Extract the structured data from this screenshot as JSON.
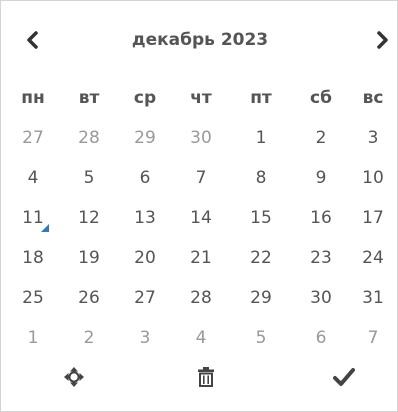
{
  "header": {
    "month_title": "декабрь 2023"
  },
  "weekdays": [
    "пн",
    "вт",
    "ср",
    "чт",
    "пт",
    "сб",
    "вс"
  ],
  "weeks": [
    [
      {
        "day": "27",
        "muted": true
      },
      {
        "day": "28",
        "muted": true
      },
      {
        "day": "29",
        "muted": true
      },
      {
        "day": "30",
        "muted": true
      },
      {
        "day": "1",
        "muted": false
      },
      {
        "day": "2",
        "muted": false
      },
      {
        "day": "3",
        "muted": false
      }
    ],
    [
      {
        "day": "4",
        "muted": false
      },
      {
        "day": "5",
        "muted": false
      },
      {
        "day": "6",
        "muted": false
      },
      {
        "day": "7",
        "muted": false
      },
      {
        "day": "8",
        "muted": false
      },
      {
        "day": "9",
        "muted": false
      },
      {
        "day": "10",
        "muted": false
      }
    ],
    [
      {
        "day": "11",
        "muted": false,
        "today": true
      },
      {
        "day": "12",
        "muted": false
      },
      {
        "day": "13",
        "muted": false
      },
      {
        "day": "14",
        "muted": false
      },
      {
        "day": "15",
        "muted": false
      },
      {
        "day": "16",
        "muted": false
      },
      {
        "day": "17",
        "muted": false
      }
    ],
    [
      {
        "day": "18",
        "muted": false
      },
      {
        "day": "19",
        "muted": false
      },
      {
        "day": "20",
        "muted": false
      },
      {
        "day": "21",
        "muted": false
      },
      {
        "day": "22",
        "muted": false
      },
      {
        "day": "23",
        "muted": false
      },
      {
        "day": "24",
        "muted": false
      }
    ],
    [
      {
        "day": "25",
        "muted": false
      },
      {
        "day": "26",
        "muted": false
      },
      {
        "day": "27",
        "muted": false
      },
      {
        "day": "28",
        "muted": false
      },
      {
        "day": "29",
        "muted": false
      },
      {
        "day": "30",
        "muted": false
      },
      {
        "day": "31",
        "muted": false
      }
    ],
    [
      {
        "day": "1",
        "muted": true
      },
      {
        "day": "2",
        "muted": true
      },
      {
        "day": "3",
        "muted": true
      },
      {
        "day": "4",
        "muted": true
      },
      {
        "day": "5",
        "muted": true
      },
      {
        "day": "6",
        "muted": true
      },
      {
        "day": "7",
        "muted": true
      }
    ]
  ],
  "icons": {
    "prev": "chevron-left-icon",
    "next": "chevron-right-icon",
    "move": "move-arrows-icon",
    "clear": "trash-icon",
    "close": "checkmark-icon"
  },
  "colors": {
    "text": "#555555",
    "muted_text": "#999999",
    "today_marker": "#337ab7",
    "border": "#d4d4d4"
  }
}
